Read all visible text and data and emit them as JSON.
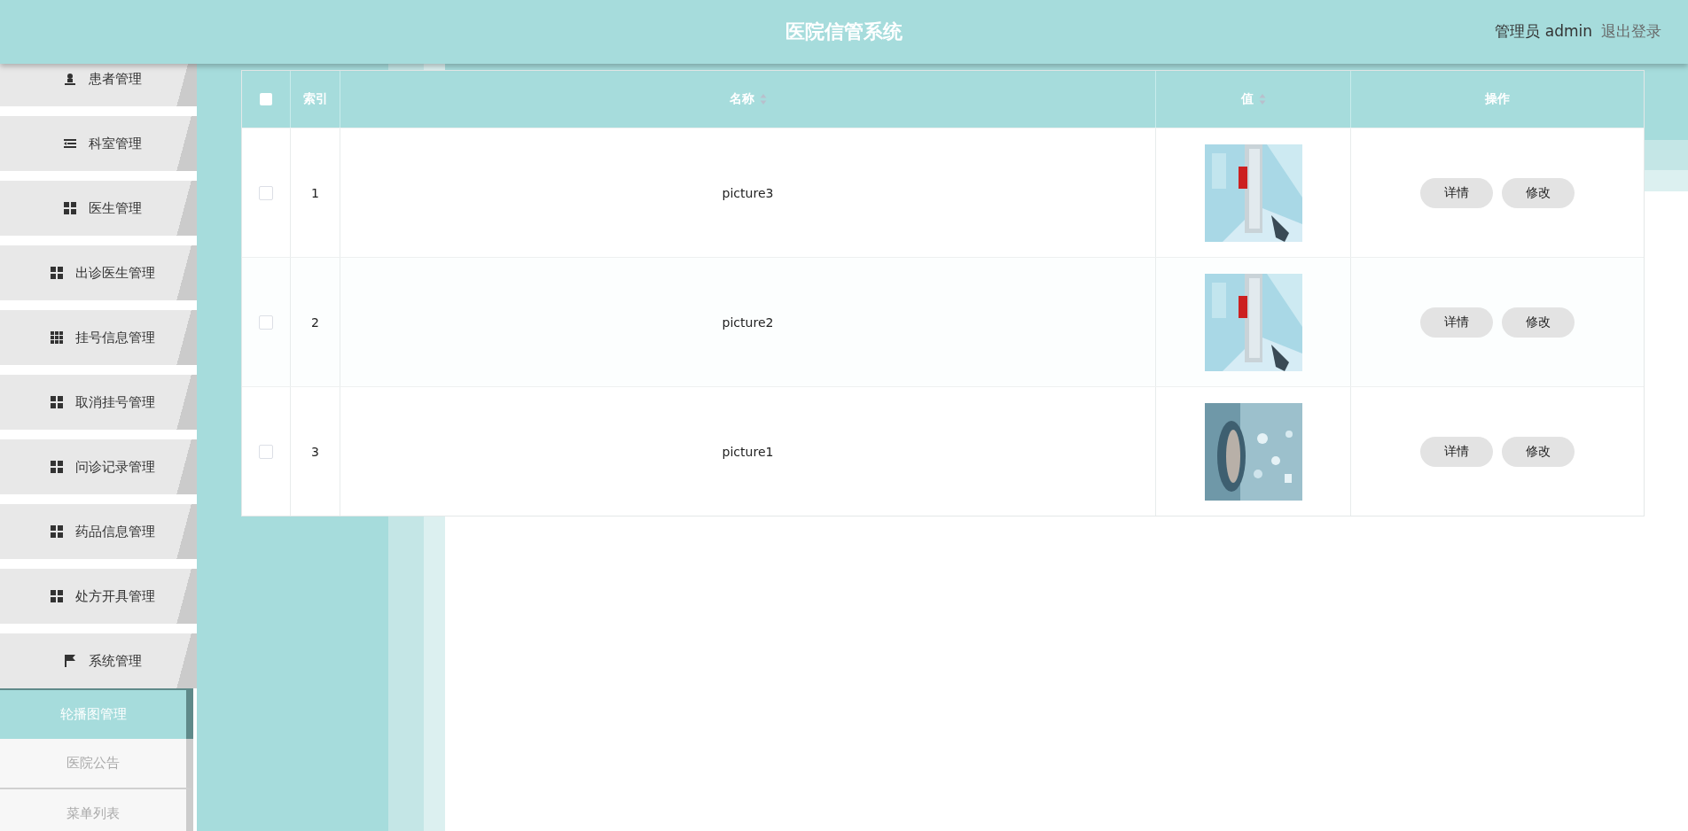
{
  "header": {
    "title": "医院信管系统",
    "user": "管理员 admin",
    "logout": "退出登录"
  },
  "sidebar": {
    "items": [
      {
        "label": "患者管理",
        "kind": "person"
      },
      {
        "label": "科室管理",
        "kind": "list"
      },
      {
        "label": "医生管理",
        "kind": "grid"
      },
      {
        "label": "出诊医生管理",
        "kind": "grid"
      },
      {
        "label": "挂号信息管理",
        "kind": "grid9"
      },
      {
        "label": "取消挂号管理",
        "kind": "grid"
      },
      {
        "label": "问诊记录管理",
        "kind": "grid"
      },
      {
        "label": "药品信息管理",
        "kind": "grid"
      },
      {
        "label": "处方开具管理",
        "kind": "grid"
      },
      {
        "label": "系统管理",
        "kind": "flag",
        "children": [
          {
            "label": "轮播图管理",
            "selected": true
          },
          {
            "label": "医院公告",
            "selected": false
          },
          {
            "label": "菜单列表",
            "selected": false
          }
        ]
      }
    ]
  },
  "table": {
    "select_all": {
      "checked": false
    },
    "columns": [
      {
        "label": "索引"
      },
      {
        "label": "名称",
        "sortable": true
      },
      {
        "label": "值",
        "sortable": true
      },
      {
        "label": "操作"
      }
    ],
    "rows": [
      {
        "checked": false,
        "index": "1",
        "name": "picture3",
        "value": {
          "kind": "picture"
        },
        "actions": [
          "详情",
          "修改"
        ]
      },
      {
        "checked": false,
        "index": "2",
        "name": "picture2",
        "value": {
          "kind": "picture"
        },
        "actions": [
          "详情",
          "修改"
        ]
      },
      {
        "checked": false,
        "index": "3",
        "name": "picture1",
        "value": {
          "kind": "picture"
        },
        "actions": [
          "详情",
          "修改"
        ]
      }
    ]
  }
}
